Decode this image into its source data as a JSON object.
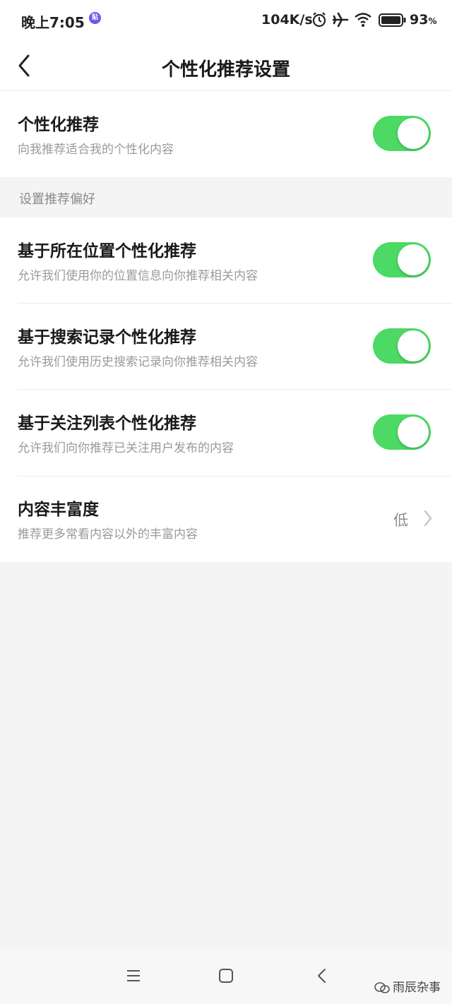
{
  "status_bar": {
    "time": "晚上7:05",
    "app_icon_text": "贴",
    "network_speed": "104K/s",
    "battery_percent": "93",
    "battery_unit": "%"
  },
  "header": {
    "title": "个性化推荐设置"
  },
  "main_setting": {
    "title": "个性化推荐",
    "description": "向我推荐适合我的个性化内容",
    "enabled": true
  },
  "section": {
    "label": "设置推荐偏好"
  },
  "preferences": [
    {
      "title": "基于所在位置个性化推荐",
      "description": "允许我们使用你的位置信息向你推荐相关内容",
      "enabled": true
    },
    {
      "title": "基于搜索记录个性化推荐",
      "description": "允许我们使用历史搜索记录向你推荐相关内容",
      "enabled": true
    },
    {
      "title": "基于关注列表个性化推荐",
      "description": "允许我们向你推荐已关注用户发布的内容",
      "enabled": true
    }
  ],
  "richness": {
    "title": "内容丰富度",
    "description": "推荐更多常看内容以外的丰富内容",
    "value": "低"
  },
  "watermark": {
    "text": "雨辰杂事"
  },
  "colors": {
    "toggle_on": "#4cd964",
    "background": "#f4f4f5"
  }
}
